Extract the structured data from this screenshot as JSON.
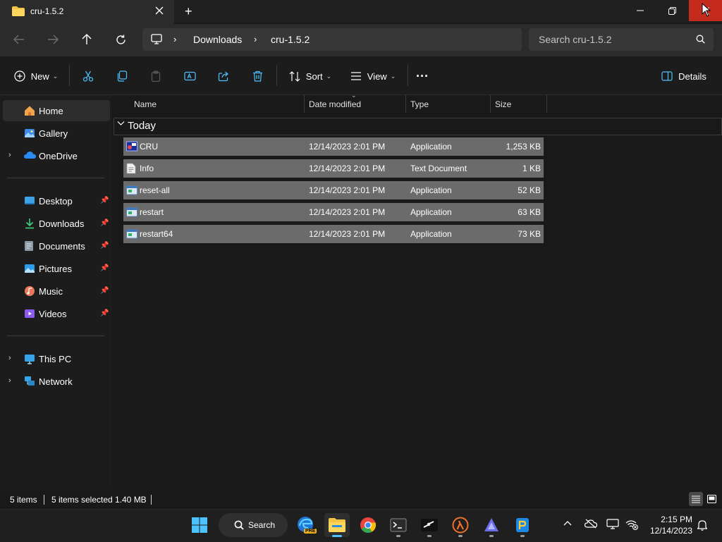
{
  "window": {
    "tab_title": "cru-1.5.2",
    "new_tab": "+"
  },
  "address": {
    "crumbs": [
      "Downloads",
      "cru-1.5.2"
    ],
    "search_placeholder": "Search cru-1.5.2"
  },
  "toolbar": {
    "new_label": "New",
    "sort_label": "Sort",
    "view_label": "View",
    "more_label": "···",
    "details_label": "Details"
  },
  "sidebar": {
    "top": [
      {
        "label": "Home",
        "icon": "home-icon"
      },
      {
        "label": "Gallery",
        "icon": "gallery-icon"
      },
      {
        "label": "OneDrive",
        "icon": "onedrive-icon"
      }
    ],
    "pinned": [
      {
        "label": "Desktop",
        "icon": "desktop-icon"
      },
      {
        "label": "Downloads",
        "icon": "downloads-icon"
      },
      {
        "label": "Documents",
        "icon": "documents-icon"
      },
      {
        "label": "Pictures",
        "icon": "pictures-icon"
      },
      {
        "label": "Music",
        "icon": "music-icon"
      },
      {
        "label": "Videos",
        "icon": "videos-icon"
      }
    ],
    "bottom": [
      {
        "label": "This PC",
        "icon": "this-pc-icon"
      },
      {
        "label": "Network",
        "icon": "network-icon"
      }
    ]
  },
  "columns": {
    "name": "Name",
    "date": "Date modified",
    "type": "Type",
    "size": "Size"
  },
  "group": {
    "label": "Today"
  },
  "files": [
    {
      "name": "CRU",
      "date": "12/14/2023 2:01 PM",
      "type": "Application",
      "size": "1,253 KB",
      "icon": "cru-app-icon"
    },
    {
      "name": "Info",
      "date": "12/14/2023 2:01 PM",
      "type": "Text Document",
      "size": "1 KB",
      "icon": "text-file-icon"
    },
    {
      "name": "reset-all",
      "date": "12/14/2023 2:01 PM",
      "type": "Application",
      "size": "52 KB",
      "icon": "app-icon"
    },
    {
      "name": "restart",
      "date": "12/14/2023 2:01 PM",
      "type": "Application",
      "size": "63 KB",
      "icon": "app-icon"
    },
    {
      "name": "restart64",
      "date": "12/14/2023 2:01 PM",
      "type": "Application",
      "size": "73 KB",
      "icon": "app-icon"
    }
  ],
  "status": {
    "items": "5 items",
    "selected": "5 items selected",
    "selected_size": "1.40 MB"
  },
  "taskbar": {
    "search_label": "Search",
    "time": "2:15 PM",
    "date": "12/14/2023",
    "edge_badge": "PRE"
  },
  "colors": {
    "selection": "#6b6b6b",
    "accent": "#4cc2ff",
    "close_hover": "#c42b1c"
  }
}
